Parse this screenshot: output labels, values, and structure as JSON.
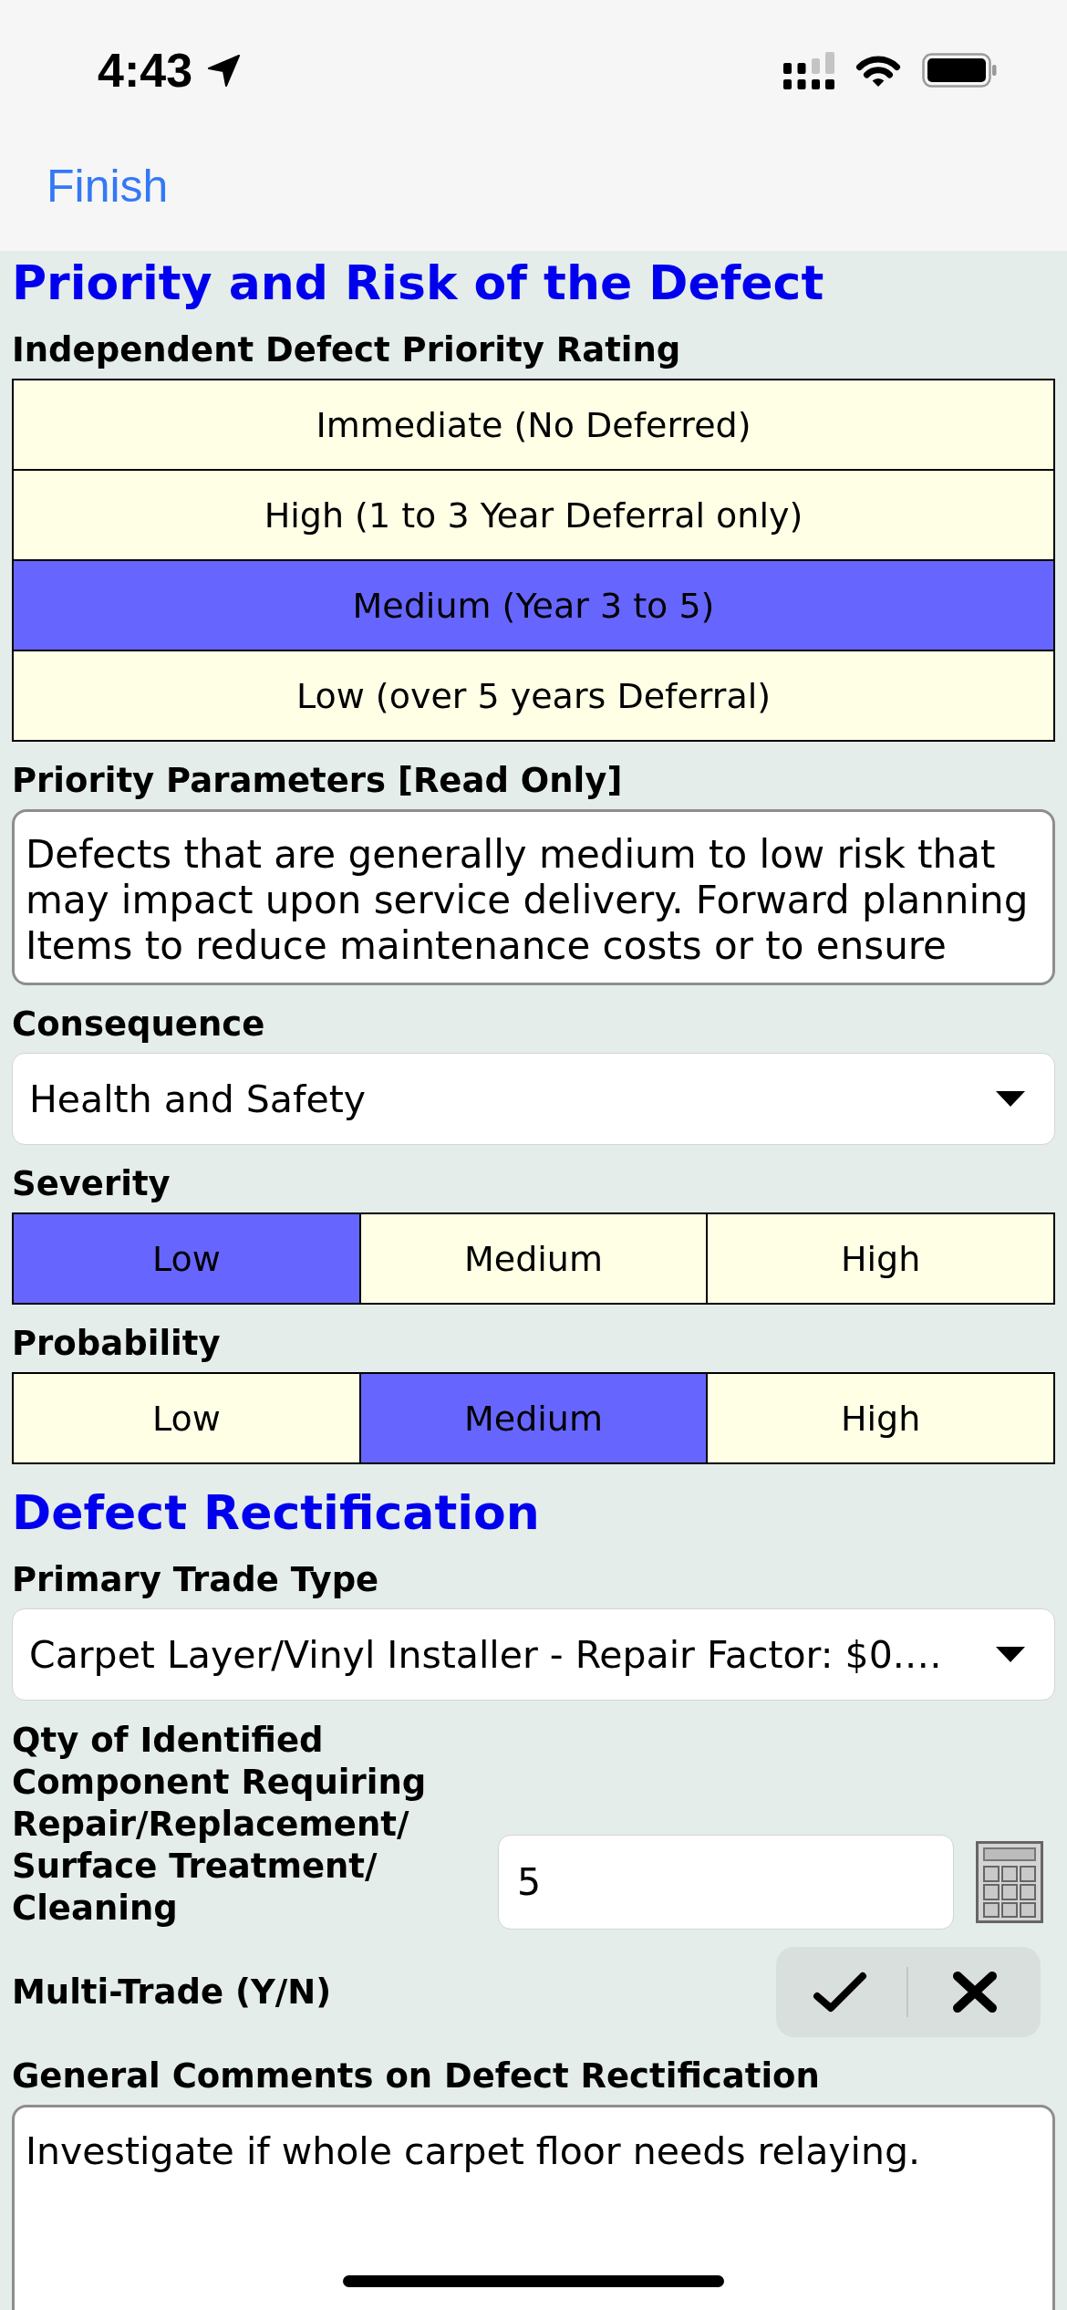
{
  "status_bar": {
    "time": "4:43"
  },
  "nav_bar": {
    "finish_button": "Finish"
  },
  "sections": [
    {
      "heading": "Priority and Risk of the Defect",
      "fields": [
        {
          "kind": "option_list",
          "label": "Independent Defect Priority Rating",
          "options": [
            {
              "label": "Immediate (No Deferred)",
              "selected": false
            },
            {
              "label": "High (1 to 3 Year Deferral only)",
              "selected": false
            },
            {
              "label": "Medium (Year 3 to 5)",
              "selected": true
            },
            {
              "label": "Low (over 5 years Deferral)",
              "selected": false
            }
          ]
        },
        {
          "kind": "read_only_text",
          "label": "Priority Parameters [Read Only]",
          "value": "Defects that are generally medium to low risk that may impact upon service delivery. Forward planning Items to reduce maintenance costs or to ensure"
        },
        {
          "kind": "dropdown",
          "label": "Consequence",
          "value": "Health and Safety"
        },
        {
          "kind": "segmented",
          "label": "Severity",
          "options": [
            {
              "label": "Low",
              "selected": true
            },
            {
              "label": "Medium",
              "selected": false
            },
            {
              "label": "High",
              "selected": false
            }
          ]
        },
        {
          "kind": "segmented",
          "label": "Probability",
          "options": [
            {
              "label": "Low",
              "selected": false
            },
            {
              "label": "Medium",
              "selected": true
            },
            {
              "label": "High",
              "selected": false
            }
          ]
        }
      ]
    },
    {
      "heading": "Defect Rectification",
      "fields": [
        {
          "kind": "dropdown",
          "label": "Primary Trade Type",
          "value": "Carpet Layer/Vinyl Installer - Repair Factor: $0.…"
        },
        {
          "kind": "number_input",
          "label": "Qty of Identified Component Requiring Repair/Replacement/ Surface Treatment/ Cleaning",
          "value": "5"
        },
        {
          "kind": "yes_no",
          "label": "Multi-Trade (Y/N)"
        },
        {
          "kind": "comment",
          "label": "General Comments on Defect Rectification",
          "value": "Investigate if whole carpet floor needs relaying."
        }
      ]
    }
  ]
}
